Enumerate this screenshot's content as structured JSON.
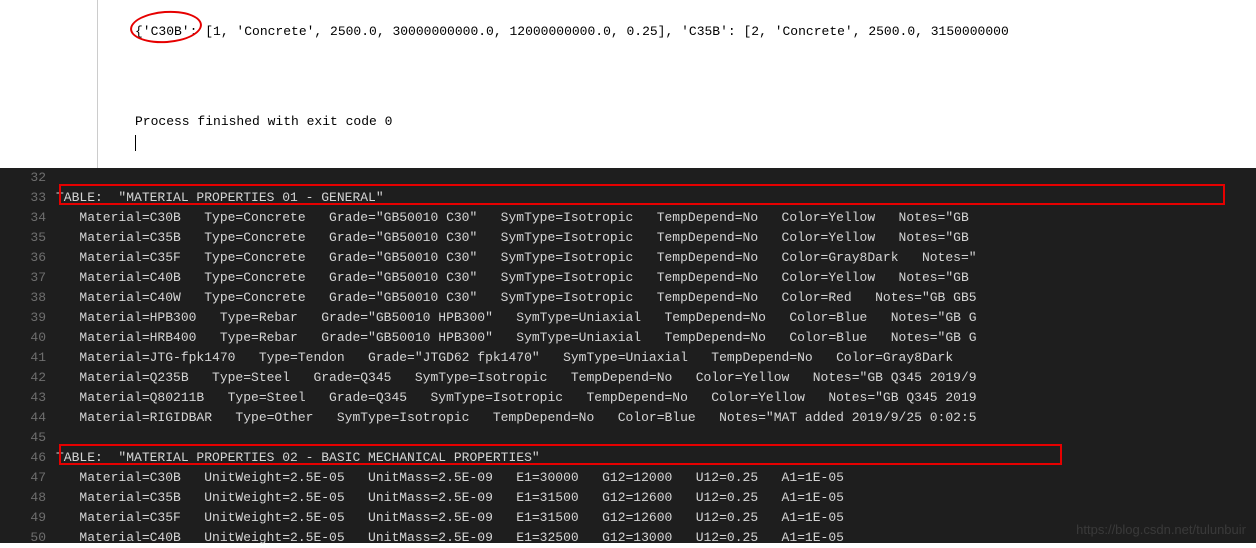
{
  "console": {
    "output": "{'C30B': [1, 'Concrete', 2500.0, 30000000000.0, 12000000000.0, 0.25], 'C35B': [2, 'Concrete', 2500.0, 3150000000",
    "process_msg": "Process finished with exit code 0"
  },
  "editor": {
    "lines": [
      {
        "n": "32",
        "t": ""
      },
      {
        "n": "33",
        "t": "TABLE:  \"MATERIAL PROPERTIES 01 - GENERAL\""
      },
      {
        "n": "34",
        "t": "   Material=C30B   Type=Concrete   Grade=\"GB50010 C30\"   SymType=Isotropic   TempDepend=No   Color=Yellow   Notes=\"GB "
      },
      {
        "n": "35",
        "t": "   Material=C35B   Type=Concrete   Grade=\"GB50010 C30\"   SymType=Isotropic   TempDepend=No   Color=Yellow   Notes=\"GB "
      },
      {
        "n": "36",
        "t": "   Material=C35F   Type=Concrete   Grade=\"GB50010 C30\"   SymType=Isotropic   TempDepend=No   Color=Gray8Dark   Notes=\""
      },
      {
        "n": "37",
        "t": "   Material=C40B   Type=Concrete   Grade=\"GB50010 C30\"   SymType=Isotropic   TempDepend=No   Color=Yellow   Notes=\"GB "
      },
      {
        "n": "38",
        "t": "   Material=C40W   Type=Concrete   Grade=\"GB50010 C30\"   SymType=Isotropic   TempDepend=No   Color=Red   Notes=\"GB GB5"
      },
      {
        "n": "39",
        "t": "   Material=HPB300   Type=Rebar   Grade=\"GB50010 HPB300\"   SymType=Uniaxial   TempDepend=No   Color=Blue   Notes=\"GB G"
      },
      {
        "n": "40",
        "t": "   Material=HRB400   Type=Rebar   Grade=\"GB50010 HPB300\"   SymType=Uniaxial   TempDepend=No   Color=Blue   Notes=\"GB G"
      },
      {
        "n": "41",
        "t": "   Material=JTG-fpk1470   Type=Tendon   Grade=\"JTGD62 fpk1470\"   SymType=Uniaxial   TempDepend=No   Color=Gray8Dark   "
      },
      {
        "n": "42",
        "t": "   Material=Q235B   Type=Steel   Grade=Q345   SymType=Isotropic   TempDepend=No   Color=Yellow   Notes=\"GB Q345 2019/9"
      },
      {
        "n": "43",
        "t": "   Material=Q80211B   Type=Steel   Grade=Q345   SymType=Isotropic   TempDepend=No   Color=Yellow   Notes=\"GB Q345 2019"
      },
      {
        "n": "44",
        "t": "   Material=RIGIDBAR   Type=Other   SymType=Isotropic   TempDepend=No   Color=Blue   Notes=\"MAT added 2019/9/25 0:02:5"
      },
      {
        "n": "45",
        "t": ""
      },
      {
        "n": "46",
        "t": "TABLE:  \"MATERIAL PROPERTIES 02 - BASIC MECHANICAL PROPERTIES\""
      },
      {
        "n": "47",
        "t": "   Material=C30B   UnitWeight=2.5E-05   UnitMass=2.5E-09   E1=30000   G12=12000   U12=0.25   A1=1E-05"
      },
      {
        "n": "48",
        "t": "   Material=C35B   UnitWeight=2.5E-05   UnitMass=2.5E-09   E1=31500   G12=12600   U12=0.25   A1=1E-05"
      },
      {
        "n": "49",
        "t": "   Material=C35F   UnitWeight=2.5E-05   UnitMass=2.5E-09   E1=31500   G12=12600   U12=0.25   A1=1E-05"
      },
      {
        "n": "50",
        "t": "   Material=C40B   UnitWeight=2.5E-05   UnitMass=2.5E-09   E1=32500   G12=13000   U12=0.25   A1=1E-05"
      }
    ]
  },
  "watermark": "https://blog.csdn.net/tulunbuir"
}
